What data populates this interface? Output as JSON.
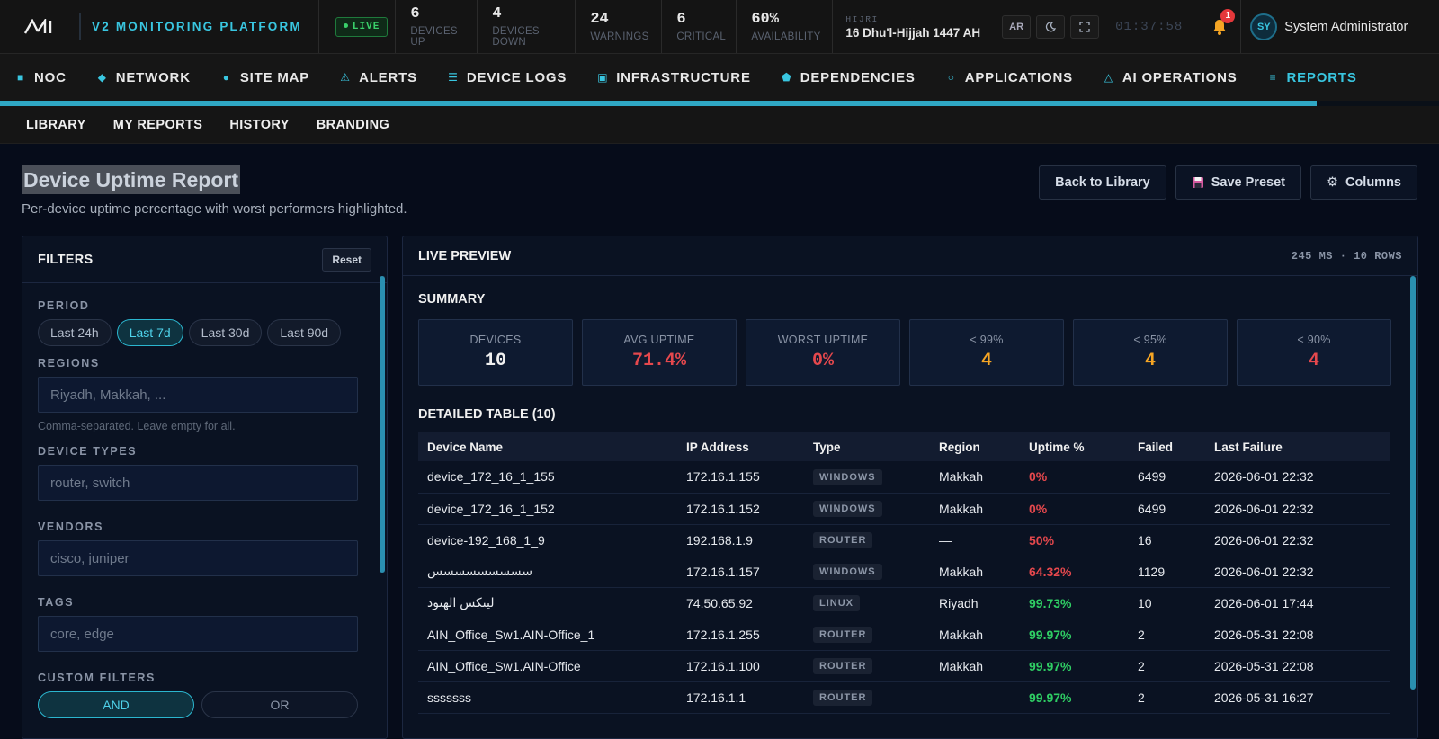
{
  "app": {
    "title": "V2 MONITORING PLATFORM",
    "live": "LIVE"
  },
  "stats": [
    {
      "value": "6",
      "label": "DEVICES UP"
    },
    {
      "value": "4",
      "label": "DEVICES DOWN"
    },
    {
      "value": "24",
      "label": "WARNINGS"
    },
    {
      "value": "6",
      "label": "CRITICAL"
    },
    {
      "value": "60%",
      "label": "AVAILABILITY"
    }
  ],
  "hijri": {
    "label": "HIJRI",
    "date": "16 Dhu'l-Hijjah 1447 AH"
  },
  "toolbar": {
    "lang": "AR",
    "clock": "01:37:58",
    "notifications": "1"
  },
  "user": {
    "initials": "SY",
    "name": "System Administrator"
  },
  "nav": [
    {
      "label": "NOC",
      "icon": "square-icon"
    },
    {
      "label": "NETWORK",
      "icon": "diamond-icon"
    },
    {
      "label": "SITE MAP",
      "icon": "circle-icon"
    },
    {
      "label": "ALERTS",
      "icon": "warning-icon"
    },
    {
      "label": "DEVICE LOGS",
      "icon": "list-icon"
    },
    {
      "label": "INFRASTRUCTURE",
      "icon": "server-icon"
    },
    {
      "label": "DEPENDENCIES",
      "icon": "pentagon-icon"
    },
    {
      "label": "APPLICATIONS",
      "icon": "ring-icon"
    },
    {
      "label": "AI OPERATIONS",
      "icon": "triangle-icon"
    },
    {
      "label": "REPORTS",
      "icon": "menu-icon"
    }
  ],
  "load_progress": 0.915,
  "subnav": [
    "LIBRARY",
    "MY REPORTS",
    "HISTORY",
    "BRANDING"
  ],
  "page": {
    "title": "Device Uptime Report",
    "description": "Per-device uptime percentage with worst performers highlighted.",
    "back": "Back to Library",
    "save": "Save Preset",
    "columns": "Columns"
  },
  "filters": {
    "title": "FILTERS",
    "reset": "Reset",
    "period_label": "PERIOD",
    "periods": [
      "Last 24h",
      "Last 7d",
      "Last 30d",
      "Last 90d"
    ],
    "regions_label": "REGIONS",
    "regions_placeholder": "Riyadh, Makkah, ...",
    "regions_help": "Comma-separated. Leave empty for all.",
    "types_label": "DEVICE TYPES",
    "types_placeholder": "router, switch",
    "vendors_label": "VENDORS",
    "vendors_placeholder": "cisco, juniper",
    "tags_label": "TAGS",
    "tags_placeholder": "core, edge",
    "custom_label": "CUSTOM FILTERS",
    "and": "AND",
    "or": "OR"
  },
  "preview": {
    "title": "LIVE PREVIEW",
    "meta": "245 MS · 10 ROWS",
    "summary_title": "SUMMARY",
    "cards": [
      {
        "label": "DEVICES",
        "value": "10",
        "color": "#f0f0f0"
      },
      {
        "label": "AVG UPTIME",
        "value": "71.4%",
        "color": "#e5484d"
      },
      {
        "label": "WORST UPTIME",
        "value": "0%",
        "color": "#e5484d"
      },
      {
        "label": "< 99%",
        "value": "4",
        "color": "#f5a524"
      },
      {
        "label": "< 95%",
        "value": "4",
        "color": "#f5a524"
      },
      {
        "label": "< 90%",
        "value": "4",
        "color": "#e5484d"
      }
    ],
    "table_title": "DETAILED TABLE (10)",
    "columns": [
      "Device Name",
      "IP Address",
      "Type",
      "Region",
      "Uptime %",
      "Failed",
      "Last Failure"
    ],
    "rows": [
      {
        "name": "device_172_16_1_155",
        "ip": "172.16.1.155",
        "type": "WINDOWS",
        "region": "Makkah",
        "uptime": "0%",
        "status": "red",
        "failed": "6499",
        "last": "2026-06-01 22:32"
      },
      {
        "name": "device_172_16_1_152",
        "ip": "172.16.1.152",
        "type": "WINDOWS",
        "region": "Makkah",
        "uptime": "0%",
        "status": "red",
        "failed": "6499",
        "last": "2026-06-01 22:32"
      },
      {
        "name": "device-192_168_1_9",
        "ip": "192.168.1.9",
        "type": "ROUTER",
        "region": "—",
        "uptime": "50%",
        "status": "red",
        "failed": "16",
        "last": "2026-06-01 22:32"
      },
      {
        "name": "سسسسسسسسس",
        "ip": "172.16.1.157",
        "type": "WINDOWS",
        "region": "Makkah",
        "uptime": "64.32%",
        "status": "red",
        "failed": "1129",
        "last": "2026-06-01 22:32"
      },
      {
        "name": "لينكس الهنود",
        "ip": "74.50.65.92",
        "type": "LINUX",
        "region": "Riyadh",
        "uptime": "99.73%",
        "status": "green",
        "failed": "10",
        "last": "2026-06-01 17:44"
      },
      {
        "name": "AIN_Office_Sw1.AIN-Office_1",
        "ip": "172.16.1.255",
        "type": "ROUTER",
        "region": "Makkah",
        "uptime": "99.97%",
        "status": "green",
        "failed": "2",
        "last": "2026-05-31 22:08"
      },
      {
        "name": "AIN_Office_Sw1.AIN-Office",
        "ip": "172.16.1.100",
        "type": "ROUTER",
        "region": "Makkah",
        "uptime": "99.97%",
        "status": "green",
        "failed": "2",
        "last": "2026-05-31 22:08"
      },
      {
        "name": "sssssss",
        "ip": "172.16.1.1",
        "type": "ROUTER",
        "region": "—",
        "uptime": "99.97%",
        "status": "green",
        "failed": "2",
        "last": "2026-05-31 16:27"
      }
    ]
  }
}
